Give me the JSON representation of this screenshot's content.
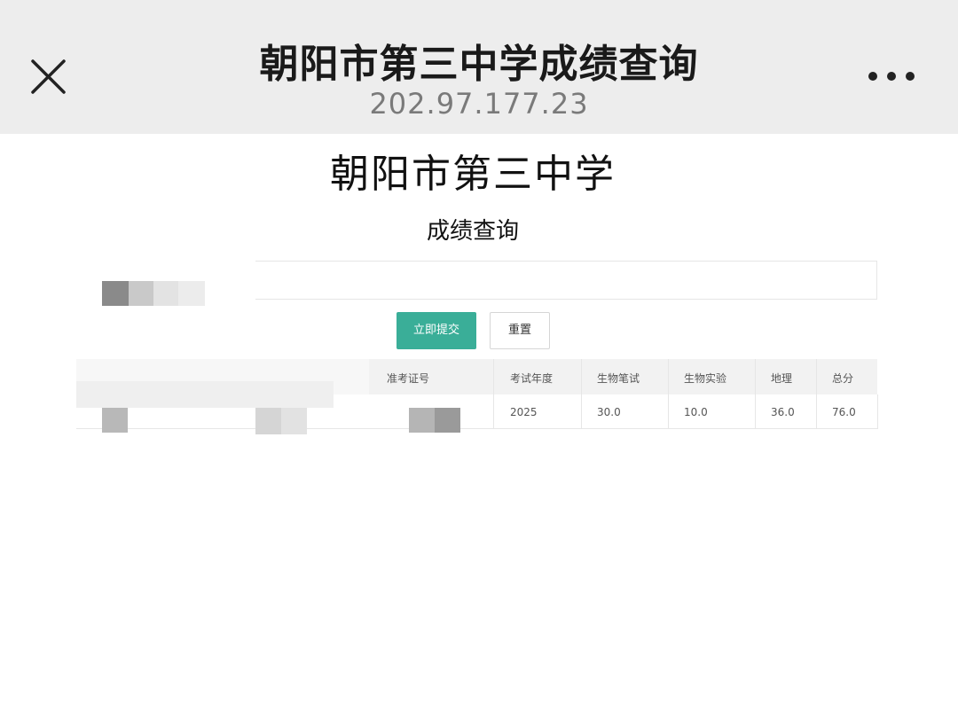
{
  "browser_bar": {
    "title": "朝阳市第三中学成绩查询",
    "url": "202.97.177.23",
    "close_icon": "close-icon",
    "more_icon": "more-icon"
  },
  "page": {
    "school_name": "朝阳市第三中学",
    "section_title": "成绩查询"
  },
  "form": {
    "submit_label": "立即提交",
    "reset_label": "重置"
  },
  "table": {
    "headers": [
      "准考证号",
      "考试年度",
      "生物笔试",
      "生物实验",
      "地理",
      "总分"
    ],
    "row": {
      "year": "2025",
      "bio_written": "30.0",
      "bio_lab": "10.0",
      "geography": "36.0",
      "total": "76.0"
    }
  },
  "colors": {
    "topbar_bg": "#ededed",
    "accent": "#3aae98",
    "table_head_bg": "#f2f2f2"
  }
}
